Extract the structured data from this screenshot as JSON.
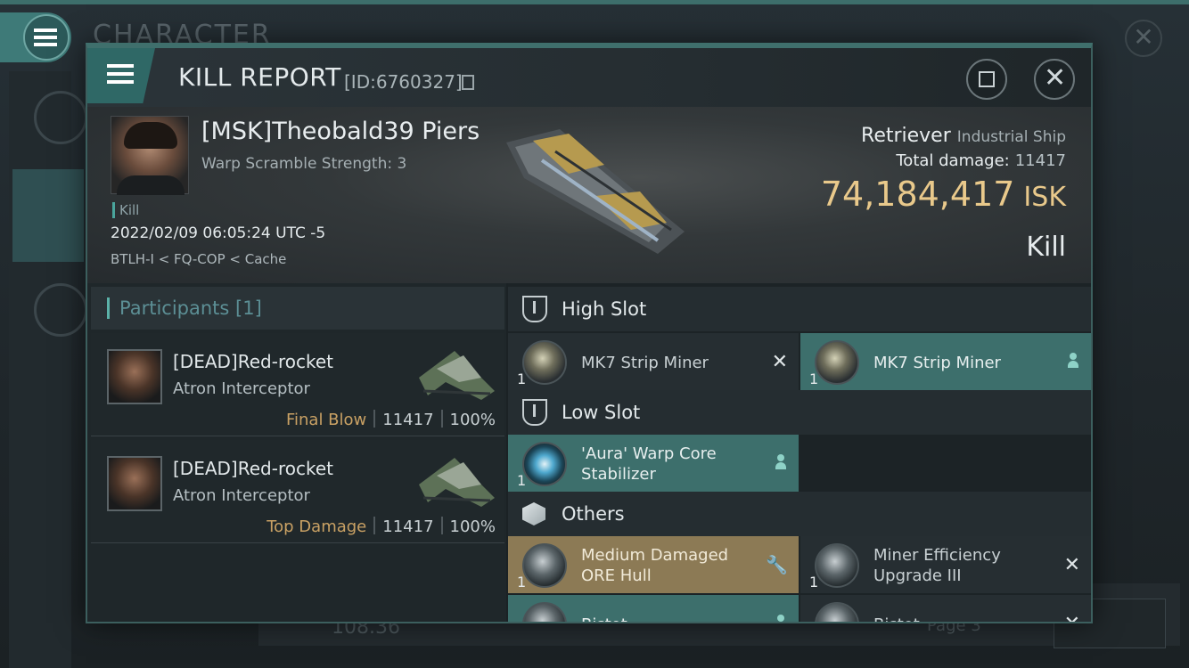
{
  "background": {
    "title": "CHARACTER",
    "counter": "108.36",
    "page": "Page 3"
  },
  "header": {
    "title": "KILL REPORT",
    "id": "[ID:6760327]"
  },
  "victim": {
    "name": "[MSK]Theobald39 Piers",
    "warp_scramble": "Warp Scramble Strength: 3",
    "tag": "Kill",
    "datetime": "2022/02/09 06:05:24 UTC -5",
    "location": "BTLH-I < FQ-COP < Cache",
    "ship_name": "Retriever",
    "ship_class": "Industrial Ship",
    "total_damage_label": "Total damage:",
    "total_damage": "11417",
    "isk_value": "74,184,417",
    "isk_unit": "ISK",
    "result": "Kill"
  },
  "participants": {
    "label": "Participants",
    "count": "[1]",
    "rows": [
      {
        "name": "[DEAD]Red-rocket",
        "ship": "Atron Interceptor",
        "tag": "Final Blow",
        "damage": "11417",
        "percent": "100%"
      },
      {
        "name": "[DEAD]Red-rocket",
        "ship": "Atron Interceptor",
        "tag": "Top Damage",
        "damage": "11417",
        "percent": "100%"
      }
    ]
  },
  "fitting": {
    "high_slot": {
      "label": "High Slot",
      "items": [
        {
          "qty": "1",
          "name": "MK7 Strip Miner",
          "status": "destroyed"
        },
        {
          "qty": "1",
          "name": "MK7 Strip Miner",
          "status": "dropped"
        }
      ]
    },
    "low_slot": {
      "label": "Low Slot",
      "items": [
        {
          "qty": "1",
          "name": "'Aura' Warp Core Stabilizer",
          "status": "dropped"
        }
      ]
    },
    "others": {
      "label": "Others",
      "items": [
        {
          "qty": "1",
          "name": "Medium Damaged ORE Hull",
          "status": "damaged"
        },
        {
          "qty": "1",
          "name": "Miner Efficiency Upgrade III",
          "status": "destroyed"
        },
        {
          "qty": "",
          "name": "Bistot",
          "status": "dropped"
        },
        {
          "qty": "",
          "name": "Bistot",
          "status": "destroyed"
        }
      ]
    }
  },
  "colors": {
    "accent": "#3f6f6c",
    "isk": "#e9c98b",
    "dropped": "#3d6f6c",
    "damaged": "#8c7a55"
  }
}
